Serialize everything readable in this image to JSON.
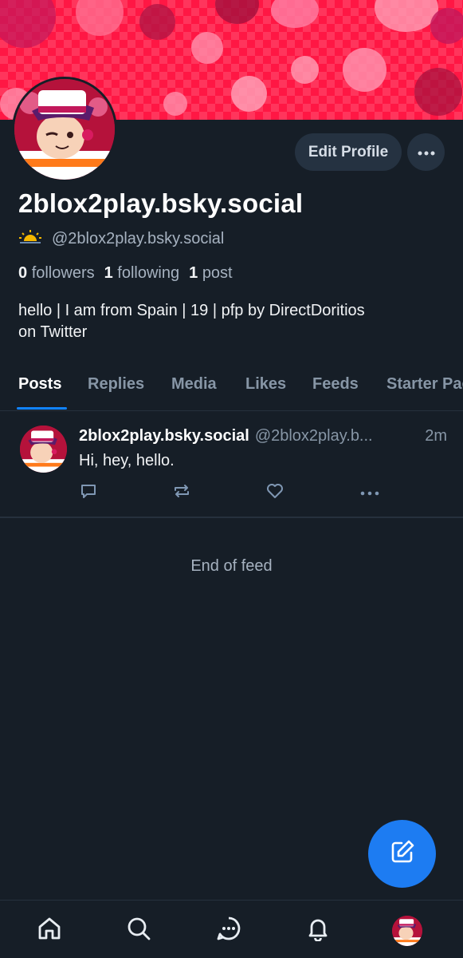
{
  "profile": {
    "display_name": "2blox2play.bsky.social",
    "handle": "@2blox2play.bsky.social",
    "handle_emoji": "sun-behind-horizon-icon",
    "stats": {
      "followers_count": "0",
      "followers_label": "followers",
      "following_count": "1",
      "following_label": "following",
      "posts_count": "1",
      "posts_label": "post"
    },
    "bio_line1": "hello | I am from Spain | 19 | pfp by DirectDoritios",
    "bio_line2": "on Twitter"
  },
  "actions": {
    "edit_profile": "Edit Profile",
    "more_icon": "ellipsis-icon"
  },
  "tabs": [
    "Posts",
    "Replies",
    "Media",
    "Likes",
    "Feeds",
    "Starter Packs"
  ],
  "active_tab": "Posts",
  "feed": {
    "posts": [
      {
        "author_name": "2blox2play.bsky.social",
        "author_handle": "@2blox2play.b...",
        "time": "2m",
        "text": "Hi, hey, hello."
      }
    ],
    "end_text": "End of feed"
  },
  "bottom_nav": [
    "home-icon",
    "search-icon",
    "chat-icon",
    "bell-icon",
    "profile-avatar"
  ],
  "colors": {
    "background": "#161e27",
    "accent": "#1083fe",
    "banner": "#ff1744",
    "button_bg": "#253241"
  }
}
